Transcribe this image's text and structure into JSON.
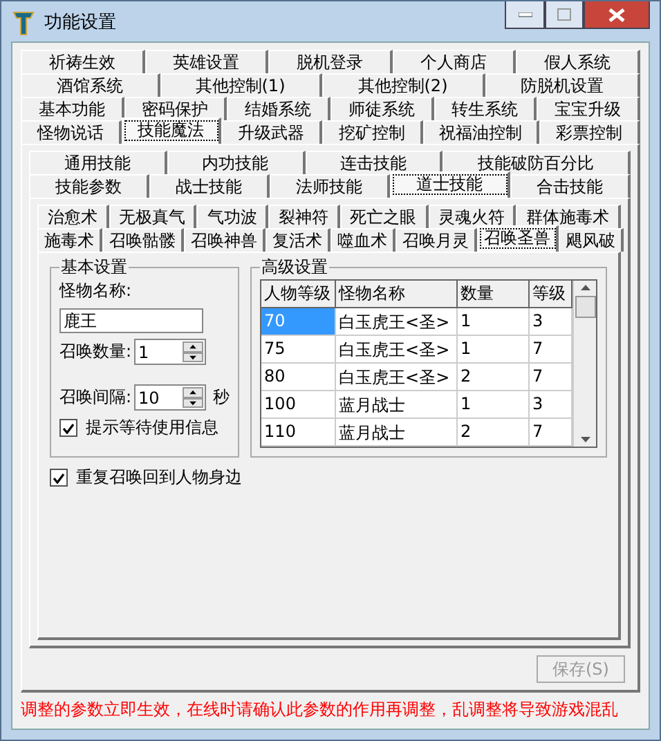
{
  "window": {
    "title": "功能设置"
  },
  "main_tabs": [
    [
      {
        "label": "祈祷生效",
        "selected": false
      },
      {
        "label": "英雄设置",
        "selected": false
      },
      {
        "label": "脱机登录",
        "selected": false
      },
      {
        "label": "个人商店",
        "selected": false
      },
      {
        "label": "假人系统",
        "selected": false
      }
    ],
    [
      {
        "label": "酒馆系统",
        "selected": false
      },
      {
        "label": "其他控制(1)",
        "selected": false
      },
      {
        "label": "其他控制(2)",
        "selected": false
      },
      {
        "label": "防脱机设置",
        "selected": false
      }
    ],
    [
      {
        "label": "基本功能",
        "selected": false
      },
      {
        "label": "密码保护",
        "selected": false
      },
      {
        "label": "结婚系统",
        "selected": false
      },
      {
        "label": "师徒系统",
        "selected": false
      },
      {
        "label": "转生系统",
        "selected": false
      },
      {
        "label": "宝宝升级",
        "selected": false
      }
    ],
    [
      {
        "label": "怪物说话",
        "selected": false
      },
      {
        "label": "技能魔法",
        "selected": true
      },
      {
        "label": "升级武器",
        "selected": false
      },
      {
        "label": "挖矿控制",
        "selected": false
      },
      {
        "label": "祝福油控制",
        "selected": false
      },
      {
        "label": "彩票控制",
        "selected": false
      }
    ]
  ],
  "skill_tabs": [
    [
      {
        "label": "通用技能",
        "selected": false
      },
      {
        "label": "内功技能",
        "selected": false
      },
      {
        "label": "连击技能",
        "selected": false
      },
      {
        "label": "技能破防百分比",
        "selected": false
      }
    ],
    [
      {
        "label": "技能参数",
        "selected": false
      },
      {
        "label": "战士技能",
        "selected": false
      },
      {
        "label": "法师技能",
        "selected": false
      },
      {
        "label": "道士技能",
        "selected": true
      },
      {
        "label": "合击技能",
        "selected": false
      }
    ]
  ],
  "spell_tabs": [
    [
      {
        "label": "治愈术",
        "selected": false
      },
      {
        "label": "无极真气",
        "selected": false
      },
      {
        "label": "气功波",
        "selected": false
      },
      {
        "label": "裂神符",
        "selected": false
      },
      {
        "label": "死亡之眼",
        "selected": false
      },
      {
        "label": "灵魂火符",
        "selected": false
      },
      {
        "label": "群体施毒术",
        "selected": false
      }
    ],
    [
      {
        "label": "施毒术",
        "selected": false
      },
      {
        "label": "召唤骷髅",
        "selected": false
      },
      {
        "label": "召唤神兽",
        "selected": false
      },
      {
        "label": "复活术",
        "selected": false
      },
      {
        "label": "噬血术",
        "selected": false
      },
      {
        "label": "召唤月灵",
        "selected": false
      },
      {
        "label": "召唤圣兽",
        "selected": true
      },
      {
        "label": "飓风破",
        "selected": false
      }
    ]
  ],
  "basic_settings": {
    "title": "基本设置",
    "monster_name_label": "怪物名称:",
    "monster_name": "鹿王",
    "summon_count_label": "召唤数量:",
    "summon_count": "1",
    "summon_interval_label": "召唤间隔:",
    "summon_interval": "10",
    "interval_unit": "秒",
    "hint_checkbox": {
      "label": "提示等待使用信息",
      "checked": true
    }
  },
  "advanced_settings": {
    "title": "高级设置",
    "columns": [
      "人物等级",
      "怪物名称",
      "数量",
      "等级"
    ],
    "rows": [
      {
        "cells": [
          "70",
          "白玉虎王<圣>",
          "1",
          "3"
        ],
        "selected": true
      },
      {
        "cells": [
          "75",
          "白玉虎王<圣>",
          "1",
          "7"
        ],
        "selected": false
      },
      {
        "cells": [
          "80",
          "白玉虎王<圣>",
          "2",
          "7"
        ],
        "selected": false
      },
      {
        "cells": [
          "100",
          "蓝月战士",
          "1",
          "3"
        ],
        "selected": false
      },
      {
        "cells": [
          "110",
          "蓝月战士",
          "2",
          "7"
        ],
        "selected": false
      }
    ]
  },
  "return_checkbox": {
    "label": "重复召唤回到人物身边",
    "checked": true
  },
  "save_button": {
    "label": "保存(S)",
    "disabled": true
  },
  "notice": "调整的参数立即生效，在线时请确认此参数的作用再调整，乱调整将导致游戏混乱"
}
